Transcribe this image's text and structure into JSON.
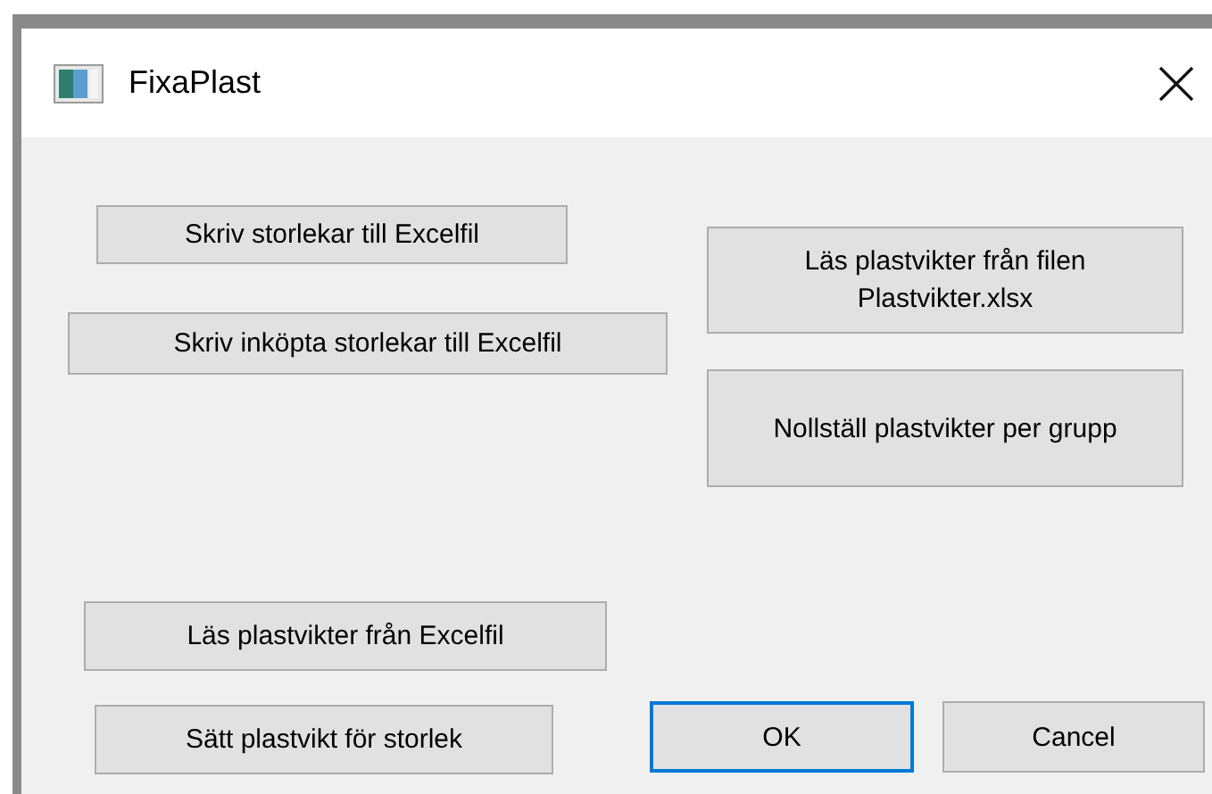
{
  "window": {
    "title": "FixaPlast"
  },
  "buttons": [
    {
      "label": "Skriv storlekar till Excelfil",
      "default": false
    },
    {
      "label": "Skriv inköpta storlekar till Excelfil",
      "default": false
    },
    {
      "label": "Läs plastvikter från filen Plastvikter.xlsx",
      "default": false
    },
    {
      "label": "Nollställ plastvikter per grupp",
      "default": false
    },
    {
      "label": "Läs plastvikter från Excelfil",
      "default": false
    },
    {
      "label": "Sätt plastvikt för storlek",
      "default": false
    },
    {
      "label": "OK",
      "default": true
    },
    {
      "label": "Cancel",
      "default": false
    }
  ]
}
